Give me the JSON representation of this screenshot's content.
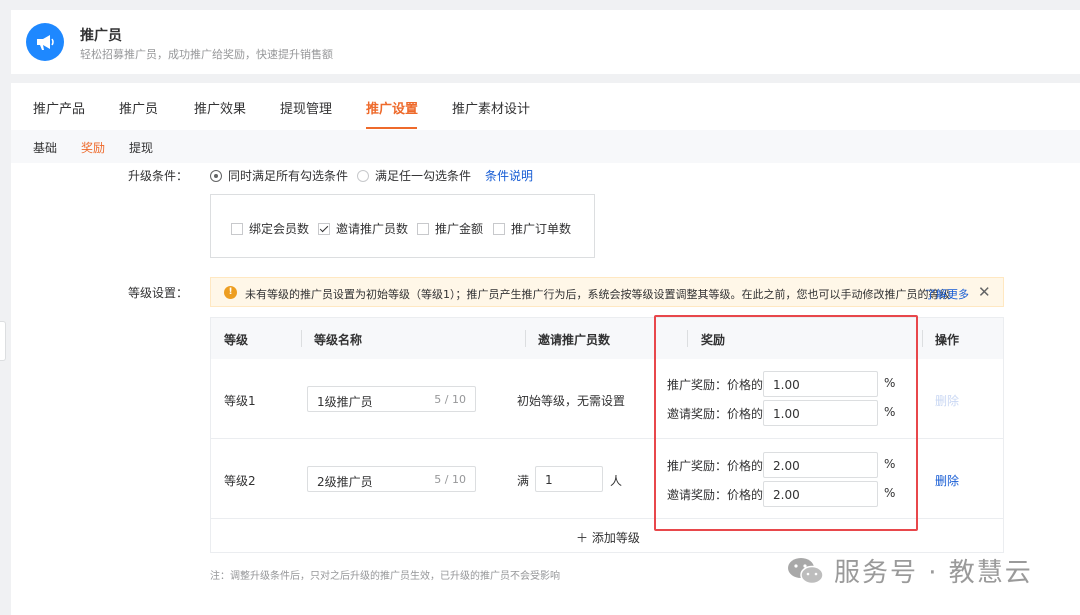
{
  "header": {
    "title": "推广员",
    "subtitle": "轻松招募推广员，成功推广给奖励，快速提升销售额",
    "logo_icon": "megaphone-icon",
    "logo_color": "#1e88ff"
  },
  "tabs": [
    "推广产品",
    "推广员",
    "推广效果",
    "提现管理",
    "推广设置",
    "推广素材设计"
  ],
  "active_tab": "推广设置",
  "subtabs": [
    "基础",
    "奖励",
    "提现"
  ],
  "active_subtab": "奖励",
  "accent_color": "#ee6a2b",
  "upgrade": {
    "label": "升级条件：",
    "option_all": "同时满足所有勾选条件",
    "option_any": "满足任一勾选条件",
    "selected": "同时满足所有勾选条件",
    "help_link": "条件说明",
    "conditions": [
      {
        "label": "绑定会员数",
        "checked": false
      },
      {
        "label": "邀请推广员数",
        "checked": true
      },
      {
        "label": "推广金额",
        "checked": false
      },
      {
        "label": "推广订单数",
        "checked": false
      }
    ]
  },
  "levels": {
    "label": "等级设置：",
    "notice": "未有等级的推广员设置为初始等级（等级1）；推广员产生推广行为后，系统会按等级设置调整其等级。在此之前，您也可以手动修改推广员的等级",
    "notice_link": "了解更多",
    "notice_close": "✕",
    "columns": [
      "等级",
      "等级名称",
      "邀请推广员数",
      "奖励",
      "操作"
    ],
    "rows": [
      {
        "level": "等级1",
        "name": "1级推广员",
        "name_count": "5 / 10",
        "invite_text": "初始等级，无需设置",
        "promo_label": "推广奖励：价格的",
        "promo_value": "1.00",
        "invite_reward_label": "邀请奖励：价格的",
        "invite_reward_value": "1.00",
        "percent": "%",
        "delete": "删除",
        "delete_enabled": false
      },
      {
        "level": "等级2",
        "name": "2级推广员",
        "name_count": "5 / 10",
        "invite_prefix": "满",
        "invite_value": "1",
        "invite_suffix": "人",
        "promo_label": "推广奖励：价格的",
        "promo_value": "2.00",
        "invite_reward_label": "邀请奖励：价格的",
        "invite_reward_value": "2.00",
        "percent": "%",
        "delete": "删除",
        "delete_enabled": true
      }
    ],
    "add_level": "＋ 添加等级",
    "footnote": "注：调整升级条件后，只对之后升级的推广员生效，已升级的推广员不会受影响"
  },
  "watermark": "服务号 · 教慧云"
}
